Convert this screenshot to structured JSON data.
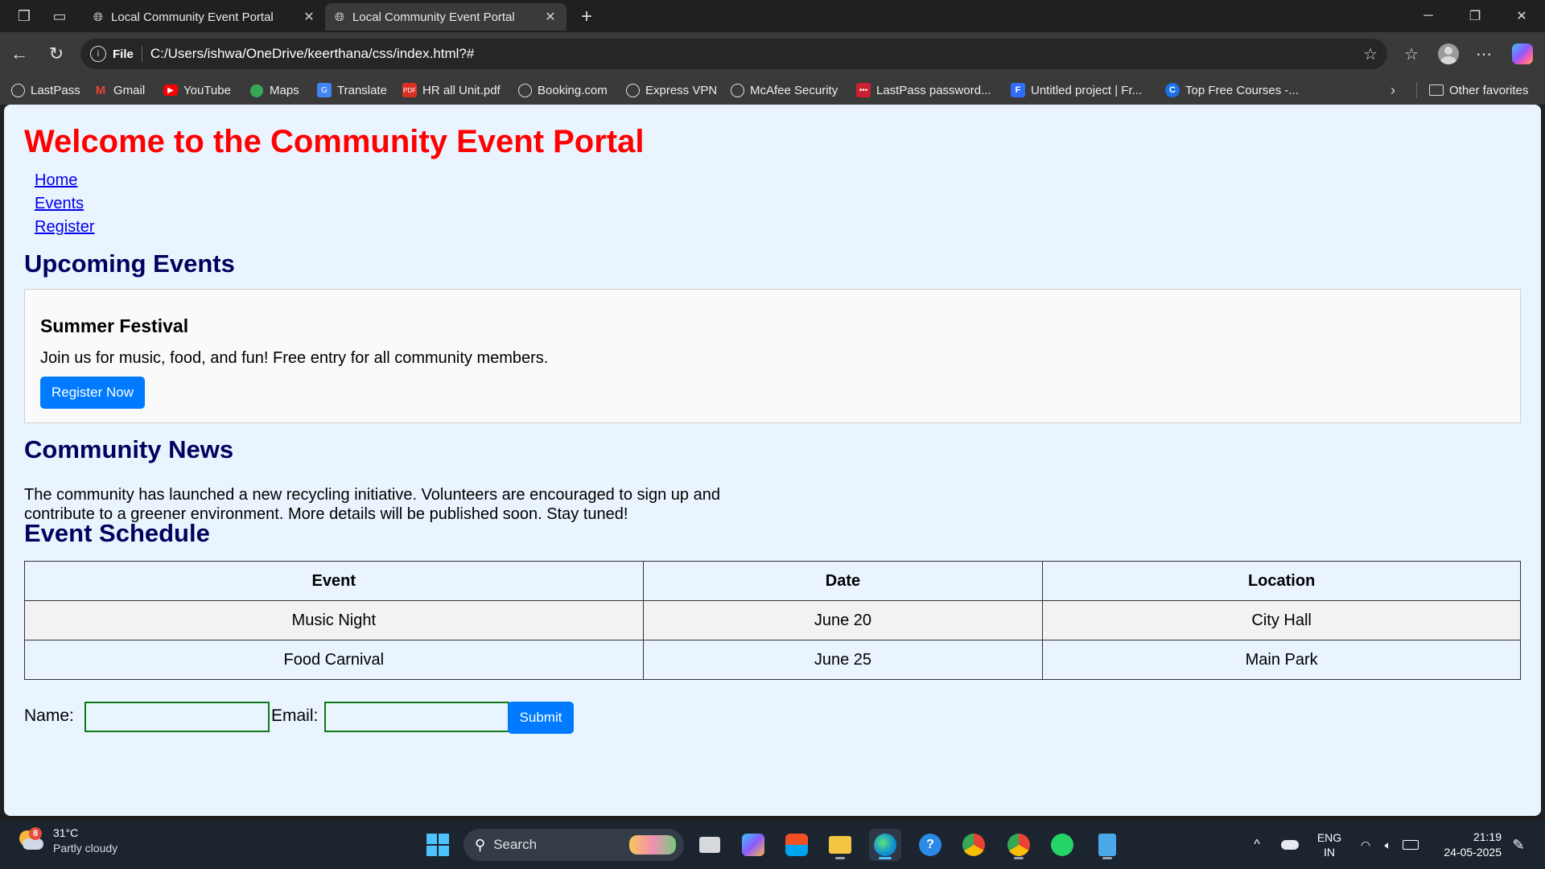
{
  "browser": {
    "tabs": [
      {
        "title": "Local Community Event Portal",
        "active": false
      },
      {
        "title": "Local Community Event Portal",
        "active": true
      }
    ],
    "address": {
      "scheme_label": "File",
      "url": "C:/Users/ishwa/OneDrive/keerthana/css/index.html?#"
    },
    "bookmarks": [
      {
        "label": "LastPass",
        "icon": "globe-icon"
      },
      {
        "label": "Gmail",
        "icon": "gmail-icon"
      },
      {
        "label": "YouTube",
        "icon": "youtube-icon"
      },
      {
        "label": "Maps",
        "icon": "maps-icon"
      },
      {
        "label": "Translate",
        "icon": "translate-icon"
      },
      {
        "label": "HR all Unit.pdf",
        "icon": "pdf-icon"
      },
      {
        "label": "Booking.com",
        "icon": "globe-icon"
      },
      {
        "label": "Express VPN",
        "icon": "globe-icon"
      },
      {
        "label": "McAfee Security",
        "icon": "globe-icon"
      },
      {
        "label": "LastPass password...",
        "icon": "lastpass-icon"
      },
      {
        "label": "Untitled project | Fr...",
        "icon": "project-icon"
      },
      {
        "label": "Top Free Courses -...",
        "icon": "courses-icon"
      }
    ],
    "other_favorites": "Other favorites"
  },
  "page": {
    "title": "Welcome to the Community Event Portal",
    "nav": [
      "Home",
      "Events",
      "Register"
    ],
    "upcoming_heading": "Upcoming Events",
    "event": {
      "title": "Summer Festival",
      "description": "Join us for music, food, and fun! Free entry for all community members.",
      "button": "Register Now"
    },
    "news_heading": "Community News",
    "news_text": "The community has launched a new recycling initiative. Volunteers are encouraged to sign up and contribute to a greener environment. More details will be published soon. Stay tuned!",
    "schedule_heading": "Event Schedule",
    "schedule": {
      "headers": [
        "Event",
        "Date",
        "Location"
      ],
      "rows": [
        [
          "Music Night",
          "June 20",
          "City Hall"
        ],
        [
          "Food Carnival",
          "June 25",
          "Main Park"
        ]
      ]
    },
    "form": {
      "name_label": "Name:",
      "name_value": "",
      "email_label": "Email:",
      "email_value": "",
      "submit": "Submit"
    }
  },
  "taskbar": {
    "weather": {
      "temp": "31°C",
      "condition": "Partly cloudy",
      "badge": "8"
    },
    "search_label": "Search",
    "language": {
      "line1": "ENG",
      "line2": "IN"
    },
    "clock": {
      "time": "21:19",
      "date": "24-05-2025"
    }
  },
  "colors": {
    "page_background": "#eaf4fe",
    "title_red": "#ff0000",
    "heading_navy": "#00005e",
    "button_blue": "#007bff",
    "input_border_green": "#0b7a16"
  }
}
